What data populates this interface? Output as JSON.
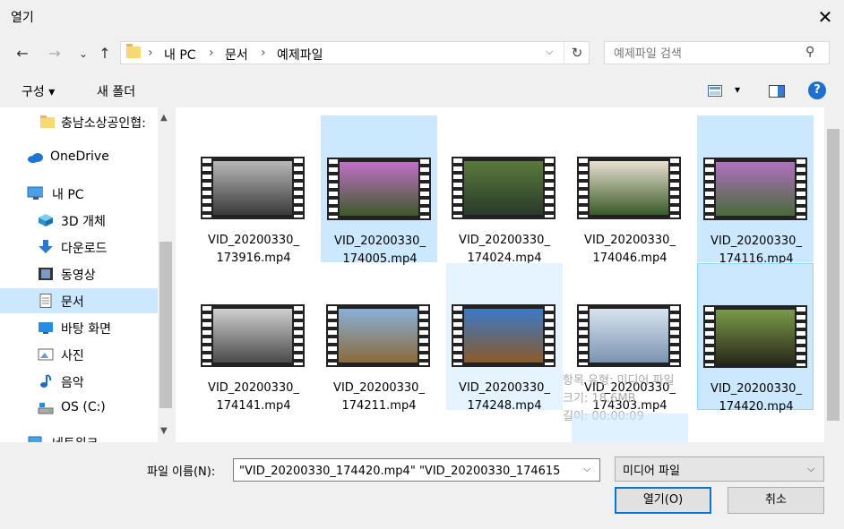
{
  "window": {
    "title": "열기",
    "close_glyph": "✕"
  },
  "nav": {
    "back": "←",
    "forward": "→",
    "recent": "⌄",
    "up": "↑"
  },
  "address": {
    "crumbs": [
      "내 PC",
      "문서",
      "예제파일"
    ],
    "separator": "›",
    "dropdown_glyph": "⌵",
    "refresh_glyph": "↻"
  },
  "search": {
    "placeholder": "예제파일 검색",
    "icon": "search-icon",
    "glyph": "⚲"
  },
  "toolbar": {
    "organize_label": "구성 ▾",
    "new_folder_label": "새 폴더",
    "view_dd": "▾",
    "help_label": "?"
  },
  "sidebar": {
    "scroll_up": "▲",
    "scroll_down": "▼",
    "items": [
      {
        "label": "충남소상공인협:",
        "icon": "folder-icon"
      },
      {
        "label": "OneDrive",
        "icon": "cloud-icon"
      },
      {
        "label": "내 PC",
        "icon": "computer-icon"
      },
      {
        "label": "3D 개체",
        "icon": "cube-icon"
      },
      {
        "label": "다운로드",
        "icon": "download-icon"
      },
      {
        "label": "동영상",
        "icon": "video-icon"
      },
      {
        "label": "문서",
        "icon": "document-icon",
        "selected": true
      },
      {
        "label": "바탕 화면",
        "icon": "desktop-icon"
      },
      {
        "label": "사진",
        "icon": "picture-icon"
      },
      {
        "label": "음악",
        "icon": "music-icon"
      },
      {
        "label": "OS (C:)",
        "icon": "drive-icon"
      },
      {
        "label": "네트워크",
        "icon": "network-icon"
      }
    ]
  },
  "files": [
    {
      "line1": "VID_20200330_",
      "line2": "173916.mp4",
      "state": "none",
      "colors": [
        "#b8b8b8",
        "#3a3a3a"
      ]
    },
    {
      "line1": "VID_20200330_",
      "line2": "174005.mp4",
      "state": "selected",
      "colors": [
        "#c070c8",
        "#3d5a2a"
      ]
    },
    {
      "line1": "VID_20200330_",
      "line2": "174024.mp4",
      "state": "none",
      "colors": [
        "#5a7a3a",
        "#2a3a2a"
      ]
    },
    {
      "line1": "VID_20200330_",
      "line2": "174046.mp4",
      "state": "none",
      "colors": [
        "#e8e0d0",
        "#3a5a2a"
      ]
    },
    {
      "line1": "VID_20200330_",
      "line2": "174116.mp4",
      "state": "selected",
      "colors": [
        "#b070c0",
        "#4a6a3a"
      ]
    },
    {
      "line1": "VID_20200330_",
      "line2": "174141.mp4",
      "state": "none",
      "colors": [
        "#d0d0d0",
        "#4a4a4a"
      ]
    },
    {
      "line1": "VID_20200330_",
      "line2": "174211.mp4",
      "state": "none",
      "colors": [
        "#8ab0d8",
        "#8a6a3a"
      ]
    },
    {
      "line1": "VID_20200330_",
      "line2": "174248.mp4",
      "state": "hover",
      "colors": [
        "#3a7ac8",
        "#8a5a2a"
      ]
    },
    {
      "line1": "VID_20200330_",
      "line2": "174303.mp4",
      "state": "none",
      "colors": [
        "#d8e4ee",
        "#7a94b0"
      ]
    },
    {
      "line1": "VID_20200330_",
      "line2": "174420.mp4",
      "state": "focused",
      "colors": [
        "#7a9a4a",
        "#2a2a1a"
      ]
    }
  ],
  "tooltip": {
    "lines": [
      "항목 유형: 미디어 파일",
      "크기: 18.6MB",
      "길이: 00:00:09"
    ]
  },
  "bottom": {
    "filename_label": "파일 이름(N):",
    "filename_value": "\"VID_20200330_174420.mp4\" \"VID_20200330_174615",
    "filename_dd": "⌵",
    "filetype_value": "미디어 파일",
    "filetype_dd": "⌵",
    "open_label": "열기(O)",
    "cancel_label": "취소"
  },
  "colors": {
    "selection": "#cce8ff",
    "accent": "#0078d7",
    "help": "#1e6fd0"
  }
}
